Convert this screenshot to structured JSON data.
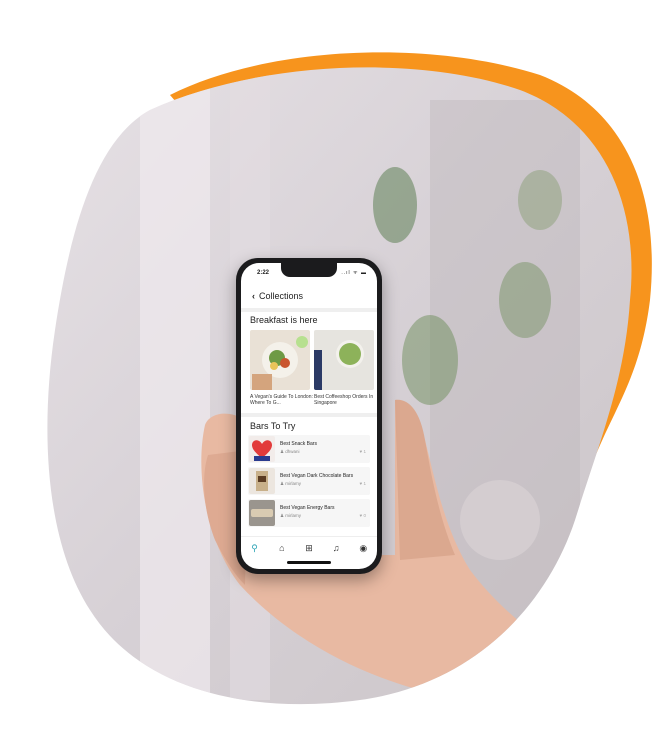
{
  "colors": {
    "accent_orange": "#f7941d",
    "teal_active": "#2aa3b5"
  },
  "status": {
    "time": "2:22",
    "icons": "..ıl ᯤ ▬"
  },
  "header": {
    "back_icon": "chevron-left-icon",
    "title": "Collections"
  },
  "breakfast": {
    "title": "Breakfast is here",
    "cards": [
      {
        "caption": "A Vegan's Guide To London: Where To G..."
      },
      {
        "caption": "Best Coffeeshop Orders In Singapore"
      }
    ]
  },
  "bars": {
    "title": "Bars To Try",
    "items": [
      {
        "title": "Best Snack Bars",
        "user": "dhwani",
        "likes": "1"
      },
      {
        "title": "Best Vegan Dark Chocolate Bars",
        "user": "mirlamy",
        "likes": "1"
      },
      {
        "title": "Best Vegan Energy Bars",
        "user": "mirlamy",
        "likes": "0"
      }
    ]
  },
  "tabbar": {
    "search": "⚲",
    "home": "⌂",
    "add": "⊞",
    "notifications": "♫",
    "profile": "◉"
  }
}
